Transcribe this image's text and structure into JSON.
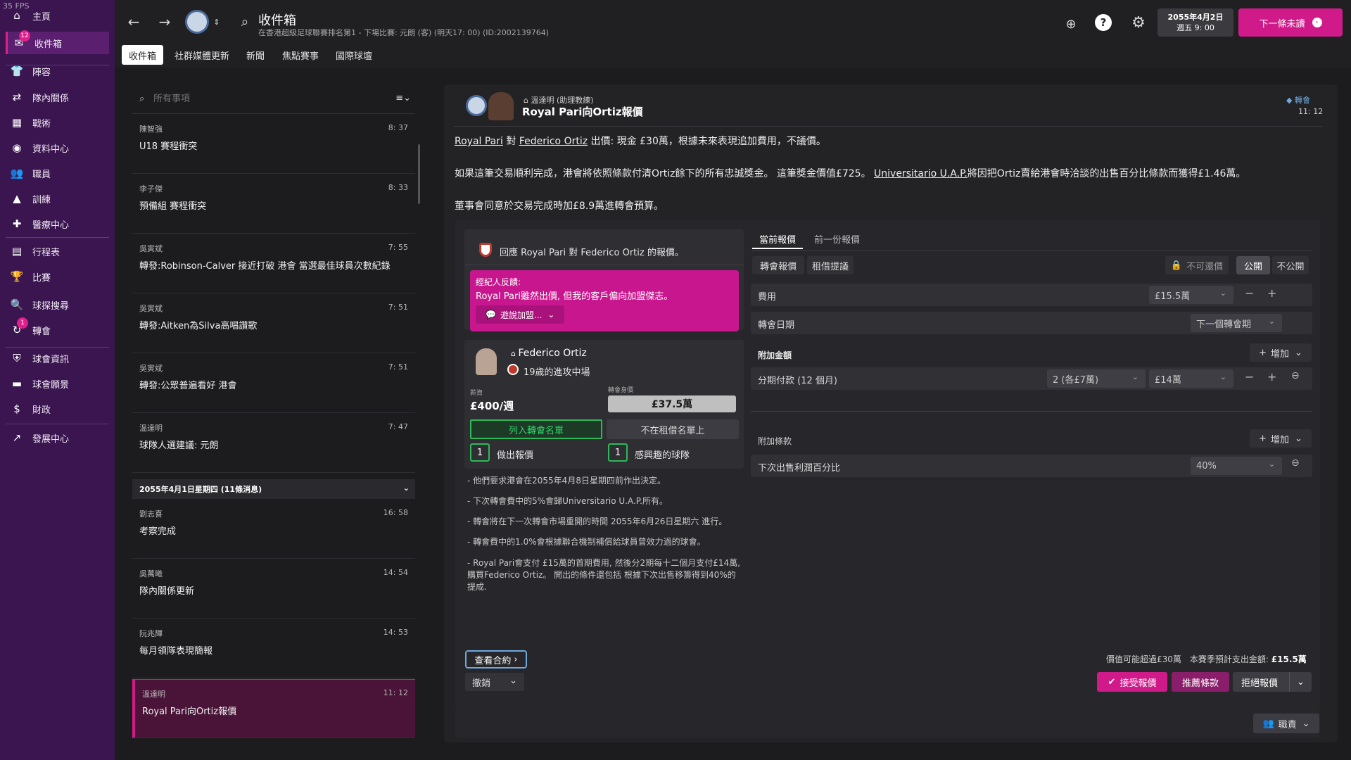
{
  "fps": "35 FPS",
  "sidebar": {
    "items": [
      {
        "label": "主頁",
        "icon": "home-icon",
        "glyph": "⌂"
      },
      {
        "label": "收件箱",
        "icon": "inbox-icon",
        "glyph": "✉",
        "badge": "12",
        "active": true
      },
      {
        "label": "陣容",
        "icon": "shirt-icon",
        "glyph": "👕"
      },
      {
        "label": "隊內關係",
        "icon": "relations-icon",
        "glyph": "⇄"
      },
      {
        "label": "戰術",
        "icon": "tactics-icon",
        "glyph": "▦"
      },
      {
        "label": "資料中心",
        "icon": "data-hub-icon",
        "glyph": "◉"
      },
      {
        "label": "職員",
        "icon": "staff-icon",
        "glyph": "👥"
      },
      {
        "label": "訓練",
        "icon": "training-icon",
        "glyph": "▲"
      },
      {
        "label": "醫療中心",
        "icon": "medical-icon",
        "glyph": "✚"
      },
      {
        "label": "行程表",
        "icon": "schedule-icon",
        "glyph": "▤"
      },
      {
        "label": "比賽",
        "icon": "trophy-icon",
        "glyph": "🏆"
      },
      {
        "label": "球探搜尋",
        "icon": "scouting-icon",
        "glyph": "🔍"
      },
      {
        "label": "轉會",
        "icon": "transfers-icon",
        "glyph": "↻",
        "badge": "1"
      },
      {
        "label": "球會資訊",
        "icon": "club-info-icon",
        "glyph": "⛨"
      },
      {
        "label": "球會願景",
        "icon": "club-vision-icon",
        "glyph": "▬"
      },
      {
        "label": "財政",
        "icon": "finances-icon",
        "glyph": "$"
      },
      {
        "label": "發展中心",
        "icon": "development-icon",
        "glyph": "↗"
      }
    ]
  },
  "header": {
    "title": "收件箱",
    "subtitle": "在香港超級足球聯賽排名第1 - 下場比賽: 元朗 (客) (明天17: 00) (ID:2002139764)",
    "tabs": [
      "收件箱",
      "社群媒體更新",
      "新聞",
      "焦點賽事",
      "國際球壇"
    ],
    "date_line1": "2055年4月2日",
    "date_line2": "週五 9: 00",
    "continue_label": "下一條未讀"
  },
  "inbox": {
    "search_placeholder": "所有事項",
    "messages": [
      {
        "from": "陳智強",
        "time": "8: 37",
        "subject": "U18 賽程衝突"
      },
      {
        "from": "李子傑",
        "time": "8: 33",
        "subject": "預備組 賽程衝突"
      },
      {
        "from": "吳寅斌",
        "time": "7: 55",
        "subject": "轉發:Robinson-Calver 接近打破 港會 當選最佳球員次數紀錄"
      },
      {
        "from": "吳寅斌",
        "time": "7: 51",
        "subject": "轉發:Aitken為Silva高唱讚歌"
      },
      {
        "from": "吳寅斌",
        "time": "7: 51",
        "subject": "轉發:公眾普遍看好 港會"
      },
      {
        "from": "溫達明",
        "time": "7: 47",
        "subject": "球隊人選建議: 元朗"
      }
    ],
    "day_header": "2055年4月1日星期四 (11條消息)",
    "messages2": [
      {
        "from": "劉志喜",
        "time": "16: 58",
        "subject": "考察完成"
      },
      {
        "from": "吳萬曦",
        "time": "14: 54",
        "subject": "隊內關係更新"
      },
      {
        "from": "阮兆輝",
        "time": "14: 53",
        "subject": "每月領隊表現簡報"
      },
      {
        "from": "溫達明",
        "time": "11: 12",
        "subject": "Royal Pari向Ortiz報價"
      }
    ]
  },
  "message": {
    "sender": "溫達明 (助理教練)",
    "title": "Royal Pari向Ortiz報價",
    "tag": "轉會",
    "time": "11: 12",
    "p1_a": "Royal Pari",
    "p1_b": " 對 ",
    "p1_c": "Federico Ortiz",
    "p1_d": " 出價: 現金 £30萬，根據未來表現追加費用，不議價。",
    "p2_a": "如果這筆交易順利完成，港會將依照條款付清Ortiz餘下的所有忠誠獎金。 這筆獎金價值£725。 ",
    "p2_b": "Universitario U.A.P.",
    "p2_c": "將因把Ortiz賣給港會時洽談的出售百分比條款而獲得£1.46萬。",
    "p3": "董事會同意於交易完成時加£8.9萬進轉會預算。"
  },
  "offer": {
    "respond_title": "回應 Royal Pari 對 Federico Ortiz 的報價。",
    "agent_label": "經紀人反饋:",
    "agent_text": "Royal Pari雖然出價, 但我的客戶偏向加盟傑志。",
    "persuade_label": "遊說加盟...",
    "player_name": "Federico Ortiz",
    "player_desc": "19歲的進攻中場",
    "wage_label": "薪資",
    "wage_value": "£400/週",
    "value_label": "轉會身價",
    "value_value": "£37.5萬",
    "listed_label": "列入轉會名單",
    "loan_label": "不在租借名單上",
    "offers_count": "1",
    "offers_label": "做出報價",
    "interested_count": "1",
    "interested_label": "感興趣的球隊",
    "notes": [
      "- 他們要求港會在2055年4月8日星期四前作出決定。",
      "- 下次轉會費中的5%會歸Universitario U.A.P.所有。",
      "- 轉會將在下一次轉會市場重開的時間 2055年6月26日星期六 進行。",
      "- 轉會費中的1.0%會根據聯合機制補償給球員曾效力過的球會。",
      "- Royal Pari會支付 £15萬的首期費用, 然後分2期每十二個月支付£14萬, 購買Federico Ortiz。 開出的條件還包括 根據下次出售移籌得到40%的提成."
    ],
    "view_contract": "查看合約",
    "undo": "撤銷",
    "tab_current": "當前報價",
    "tab_prev": "前一份報價",
    "subtab_transfer": "轉會報價",
    "subtab_loan": "租借提議",
    "non_refundable": "不可還價",
    "public": "公開",
    "private": "不公開",
    "fee_label": "費用",
    "fee_value": "£15.5萬",
    "date_label": "轉會日期",
    "date_value": "下一個轉會期",
    "add_amount_label": "附加金額",
    "add_btn": "增加",
    "installments_label": "分期付款 (12 個月)",
    "installments_count": "2 (各£7萬)",
    "installments_value": "£14萬",
    "clauses_label": "附加條款",
    "sell_on_label": "下次出售利潤百分比",
    "sell_on_value": "40%",
    "summary_a": "價值可能超過£30萬",
    "summary_b": "本賽季預計支出金額: ",
    "summary_c": "£15.5萬",
    "accept": "接受報價",
    "suggest": "推薦條款",
    "reject": "拒絕報價",
    "staff": "職責"
  },
  "colors": {
    "accent": "#d11a8a",
    "sidebar": "#3a1550",
    "green": "#2fb85a"
  }
}
